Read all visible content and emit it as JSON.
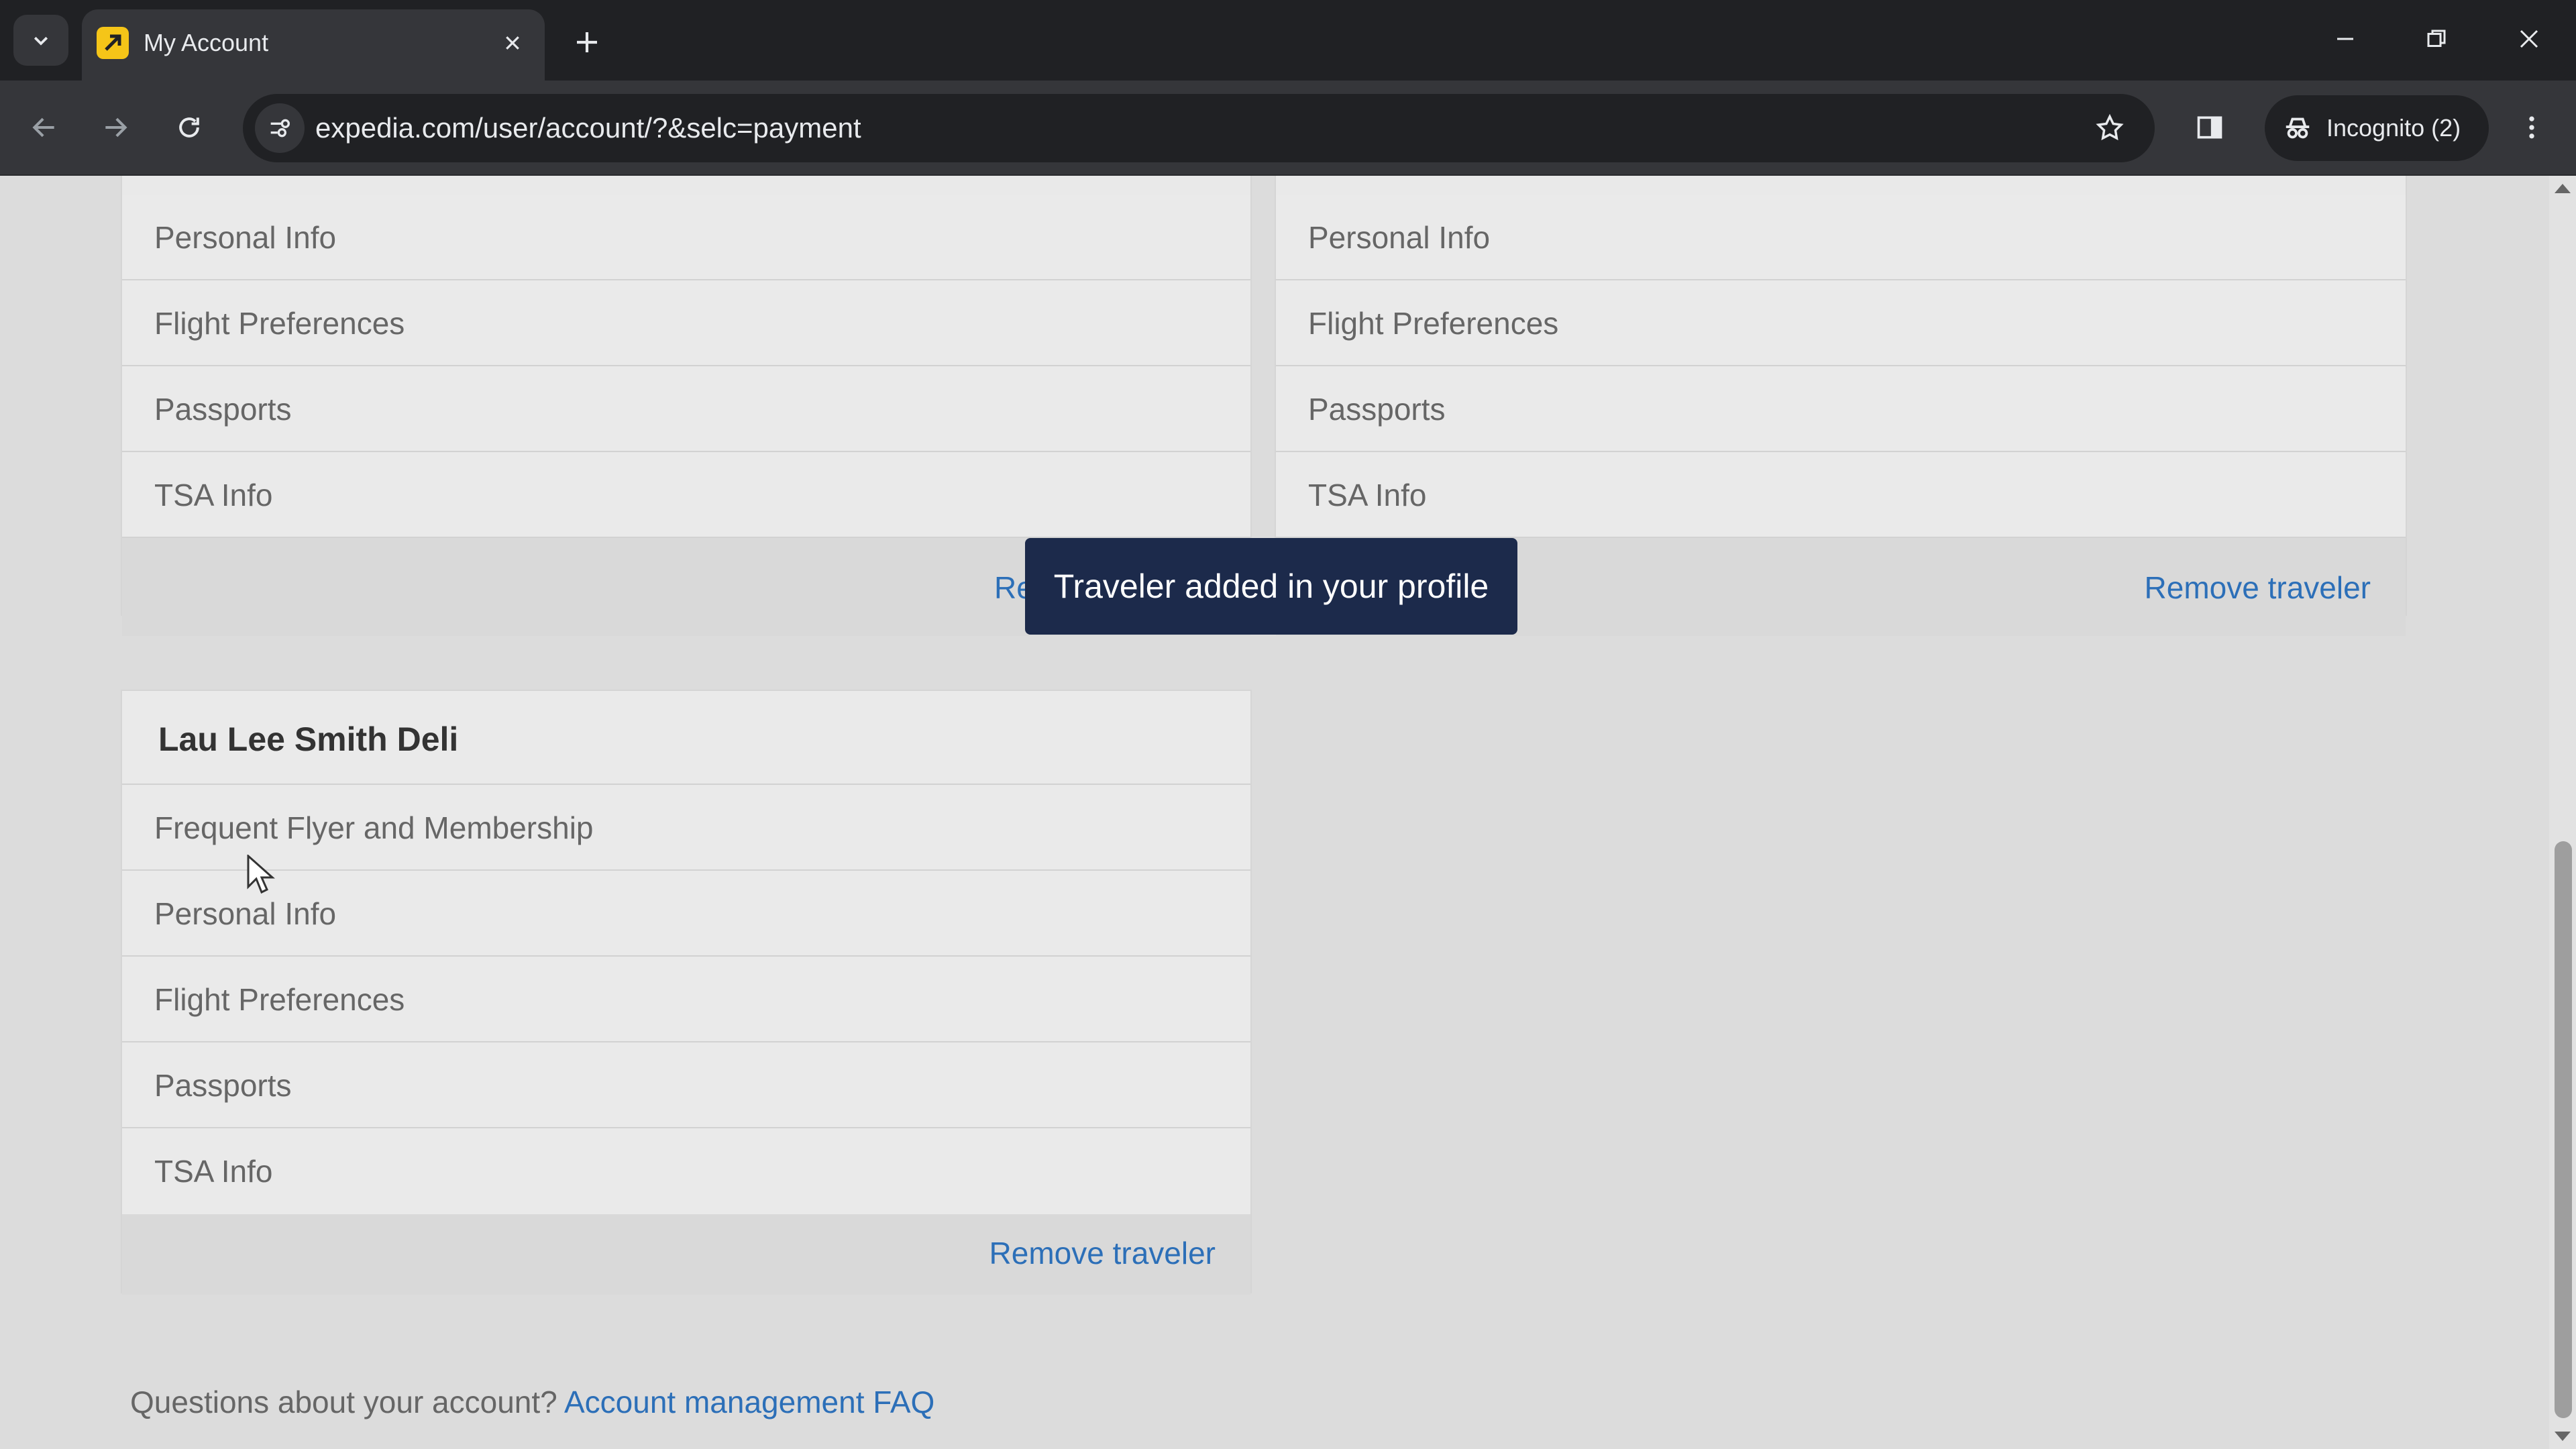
{
  "browser": {
    "tab_title": "My Account",
    "url": "expedia.com/user/account/?&selc=payment",
    "incognito_label": "Incognito (2)"
  },
  "cards": {
    "left_top": {
      "rows": [
        "Personal Info",
        "Flight Preferences",
        "Passports",
        "TSA Info"
      ],
      "remove_label": "Re"
    },
    "right_top": {
      "rows": [
        "Personal Info",
        "Flight Preferences",
        "Passports",
        "TSA Info"
      ],
      "remove_label": "Remove traveler"
    },
    "bottom": {
      "name": "Lau Lee Smith Deli",
      "rows": [
        "Frequent Flyer and Membership",
        "Personal Info",
        "Flight Preferences",
        "Passports",
        "TSA Info"
      ],
      "remove_label": "Remove traveler"
    }
  },
  "toast": {
    "message": "Traveler added in your profile"
  },
  "footer": {
    "question": "Questions about your account?",
    "faq_link": "Account management FAQ"
  },
  "colors": {
    "link": "#2c6fb8",
    "toast_bg": "#1c2a4b"
  }
}
